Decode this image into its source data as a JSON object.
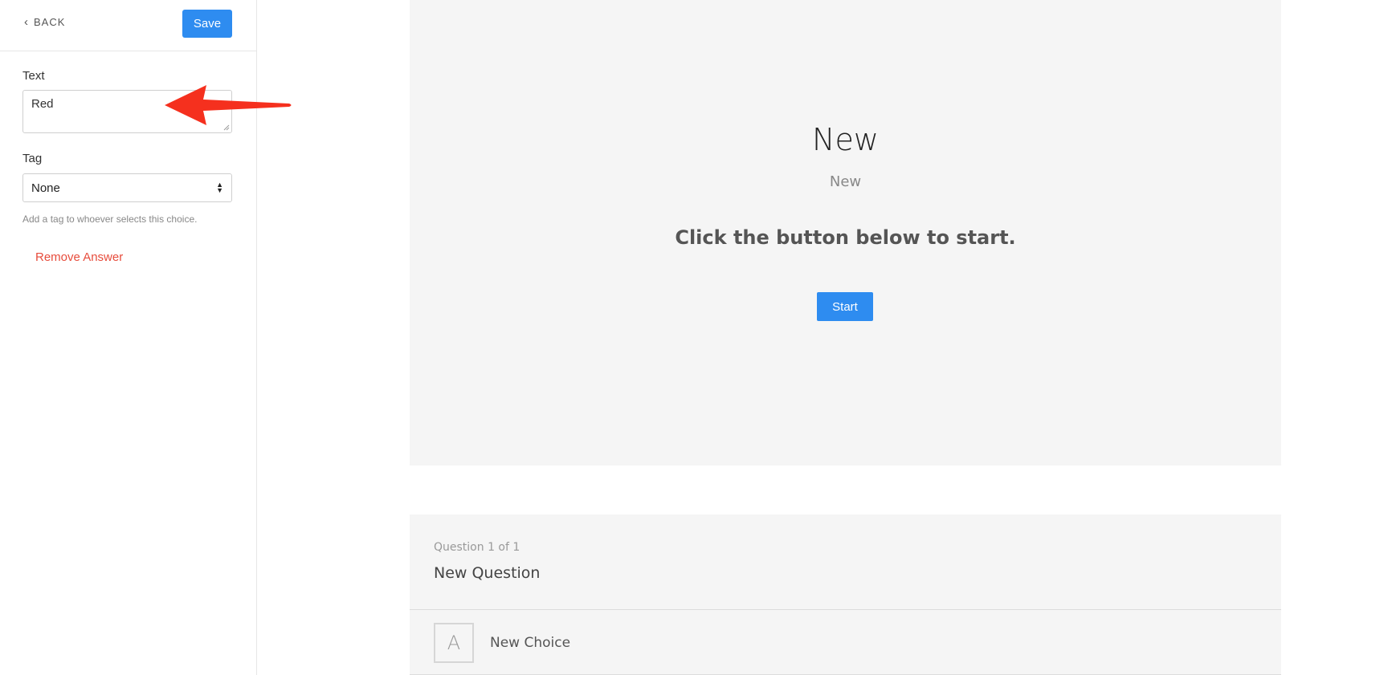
{
  "sidebar": {
    "back_label": "BACK",
    "save_label": "Save",
    "text_field": {
      "label": "Text",
      "value": "Red"
    },
    "tag_field": {
      "label": "Tag",
      "selected": "None",
      "help": "Add a tag to whoever selects this choice."
    },
    "remove_label": "Remove Answer"
  },
  "preview": {
    "title": "New",
    "subtitle": "New",
    "instruction": "Click the button below to start.",
    "start_label": "Start",
    "question": {
      "counter": "Question 1 of 1",
      "text": "New Question",
      "choices": [
        {
          "letter": "A",
          "label": "New Choice"
        }
      ]
    }
  },
  "colors": {
    "accent": "#2e8cf0",
    "danger": "#e74c3c",
    "annotation_arrow": "#f5301e",
    "card_bg": "#f5f5f5"
  }
}
